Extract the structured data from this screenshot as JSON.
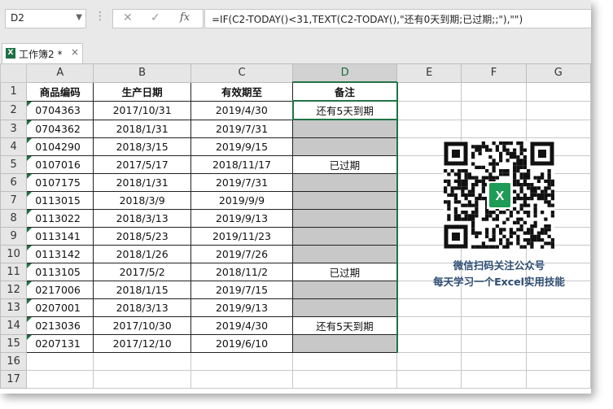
{
  "formula_bar": {
    "name_box": "D2",
    "cancel_icon": "✕",
    "enter_icon": "✓",
    "fx_label": "fx",
    "formula": "=IF(C2-TODAY()<31,TEXT(C2-TODAY(),\"还有0天到期;已过期;;\"),\"\")"
  },
  "tab": {
    "name": "工作簿2 *",
    "close": "×",
    "icon_letter": "X"
  },
  "columns": [
    "A",
    "B",
    "C",
    "D",
    "E",
    "F",
    "G"
  ],
  "selected_column": "D",
  "row_numbers": [
    "1",
    "2",
    "3",
    "4",
    "5",
    "6",
    "7",
    "8",
    "9",
    "10",
    "11",
    "12",
    "13",
    "14",
    "15",
    "16",
    "17"
  ],
  "headers": {
    "code": "商品编码",
    "production_date": "生产日期",
    "expiry": "有效期至",
    "remark": "备注"
  },
  "rows": [
    {
      "code": "0704363",
      "production_date": "2017/10/31",
      "expiry": "2019/4/30",
      "remark": "还有5天到期"
    },
    {
      "code": "0704362",
      "production_date": "2018/1/31",
      "expiry": "2019/7/31",
      "remark": ""
    },
    {
      "code": "0104290",
      "production_date": "2018/3/15",
      "expiry": "2019/9/15",
      "remark": ""
    },
    {
      "code": "0107016",
      "production_date": "2017/5/17",
      "expiry": "2018/11/17",
      "remark": "已过期"
    },
    {
      "code": "0107175",
      "production_date": "2018/1/31",
      "expiry": "2019/7/31",
      "remark": ""
    },
    {
      "code": "0113015",
      "production_date": "2018/3/9",
      "expiry": "2019/9/9",
      "remark": ""
    },
    {
      "code": "0113022",
      "production_date": "2018/3/13",
      "expiry": "2019/9/13",
      "remark": ""
    },
    {
      "code": "0113141",
      "production_date": "2018/5/23",
      "expiry": "2019/11/23",
      "remark": ""
    },
    {
      "code": "0113142",
      "production_date": "2018/1/26",
      "expiry": "2019/7/26",
      "remark": ""
    },
    {
      "code": "0113105",
      "production_date": "2017/5/2",
      "expiry": "2018/11/2",
      "remark": "已过期"
    },
    {
      "code": "0217006",
      "production_date": "2018/1/15",
      "expiry": "2019/7/15",
      "remark": ""
    },
    {
      "code": "0207001",
      "production_date": "2018/3/13",
      "expiry": "2019/9/13",
      "remark": ""
    },
    {
      "code": "0213036",
      "production_date": "2017/10/30",
      "expiry": "2019/4/30",
      "remark": "还有5天到期"
    },
    {
      "code": "0207131",
      "production_date": "2017/12/10",
      "expiry": "2019/6/10",
      "remark": ""
    }
  ],
  "qr": {
    "logo_letter": "X",
    "caption_line1": "微信扫码关注公众号",
    "caption_line2": "每天学习一个Excel实用技能"
  },
  "colors": {
    "excel_green": "#217346",
    "caption_blue": "#2e4d73",
    "shaded_cell": "#c8c8c8"
  }
}
